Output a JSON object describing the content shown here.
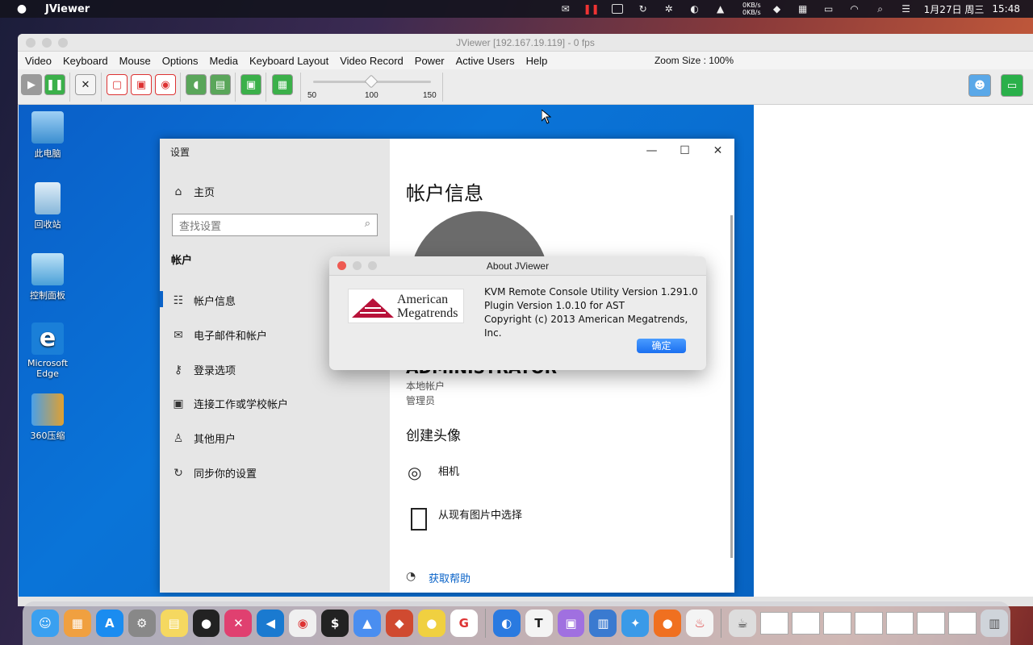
{
  "menubar": {
    "app_name": "JViewer",
    "net_speed_up": "0KB/s",
    "net_speed_down": "0KB/s",
    "date": "1月27日 周三",
    "time": "15:48"
  },
  "jviewer": {
    "title": "JViewer [192.167.19.119] - 0 fps",
    "menu": [
      "Video",
      "Keyboard",
      "Mouse",
      "Options",
      "Media",
      "Keyboard Layout",
      "Video Record",
      "Power",
      "Active Users",
      "Help"
    ],
    "zoom_label": "Zoom Size : 100%",
    "zoom_value": 100,
    "zoom_ticks": [
      "50",
      "100",
      "150"
    ]
  },
  "desktop_icons": [
    "此电脑",
    "回收站",
    "控制面板",
    "Microsoft Edge",
    "360压缩"
  ],
  "settings": {
    "window_title": "设置",
    "home": "主页",
    "search_placeholder": "查找设置",
    "section": "帐户",
    "nav": [
      "帐户信息",
      "电子邮件和帐户",
      "登录选项",
      "连接工作或学校帐户",
      "其他用户",
      "同步你的设置"
    ],
    "page_title": "帐户信息",
    "username": "ADMINISTRATOR",
    "account_type": "本地帐户",
    "role": "管理员",
    "create_avatar": "创建头像",
    "camera": "相机",
    "choose_existing": "从现有图片中选择",
    "get_help": "获取帮助"
  },
  "about": {
    "title": "About JViewer",
    "logo_line1": "American",
    "logo_line2": "Megatrends",
    "line1": "KVM Remote Console Utility Version 1.291.0",
    "line2": "Plugin Version 1.0.10 for AST",
    "line3": "Copyright (c) 2013 American Megatrends, Inc.",
    "ok": "确定"
  },
  "colors": {
    "accent": "#0a63c8",
    "ok_button": "#1a6ff0",
    "remote_desktop": "#0a6cd2"
  }
}
